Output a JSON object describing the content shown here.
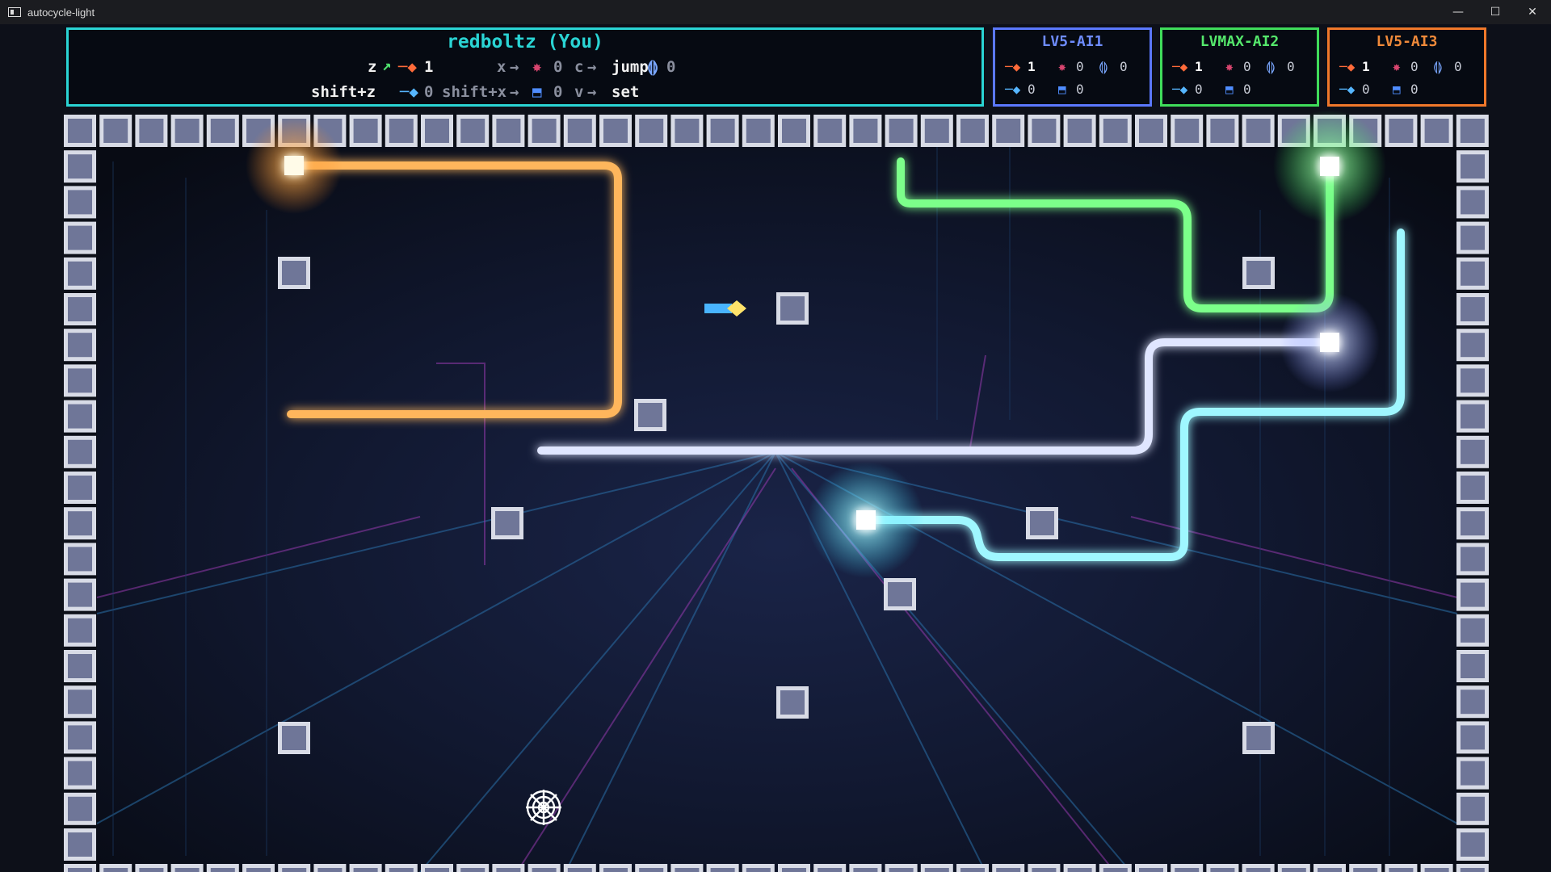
{
  "window": {
    "title": "autocycle-light",
    "minimize_icon": "minimize-icon",
    "maximize_icon": "maximize-icon",
    "close_icon": "close-icon"
  },
  "player_panel": {
    "name": "redboltz (You)",
    "color": "#2ad4d4",
    "row1": {
      "key_z": "z",
      "z_count": "1",
      "key_x": "x",
      "x_count": "0",
      "key_c": "c",
      "c_label": "jump",
      "c_count": "0"
    },
    "row2": {
      "key_shift_z": "shift+z",
      "shift_z_count": "0",
      "key_shift_x": "shift+x",
      "shift_x_count": "0",
      "key_v": "v",
      "v_label": "set"
    }
  },
  "ai_panels": [
    {
      "name": "LV5-AI1",
      "color": "#5b78ff",
      "boost": "1",
      "bomb": "0",
      "jump": "0",
      "shield": "0",
      "shot": "0"
    },
    {
      "name": "LVMAX-AI2",
      "color": "#3fdc5a",
      "boost": "1",
      "bomb": "0",
      "jump": "0",
      "shield": "0",
      "shot": "0"
    },
    {
      "name": "LV5-AI3",
      "color": "#f0782a",
      "boost": "1",
      "bomb": "0",
      "jump": "0",
      "shield": "0",
      "shot": "0"
    }
  ],
  "colors": {
    "orange_trail": "#ffb65c",
    "green_trail": "#7cff8a",
    "white_trail": "#e0e6ff",
    "cyan_trail": "#9ff7ff",
    "wall_block": "#8d93b2"
  },
  "items": [
    "boost-item",
    "web-trap-icon"
  ]
}
